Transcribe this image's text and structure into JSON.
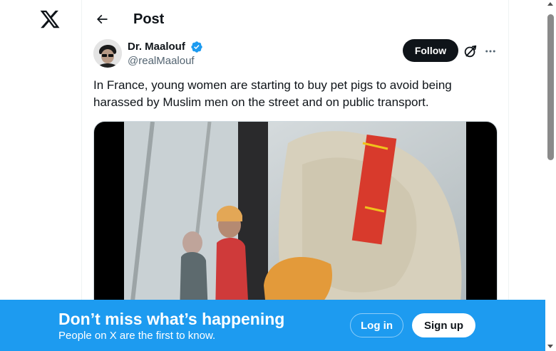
{
  "nav": {
    "logo_icon": "x-logo-icon"
  },
  "header": {
    "back_icon": "arrow-left-icon",
    "title": "Post"
  },
  "post": {
    "author": {
      "name": "Dr. Maalouf",
      "handle": "@realMaalouf",
      "verified": true,
      "verified_color": "#1d9bf0"
    },
    "follow_label": "Follow",
    "grok_icon": "grok-icon",
    "more_icon": "more-horizontal-icon",
    "text": "In France, young women are starting to buy pet pigs to avoid being harassed by Muslim men on the street and on public transport.",
    "media": {
      "type": "video"
    }
  },
  "banner": {
    "title": "Don’t miss what’s happening",
    "subtitle": "People on X are the first to know.",
    "login_label": "Log in",
    "signup_label": "Sign up",
    "background": "#1d9bf0"
  }
}
